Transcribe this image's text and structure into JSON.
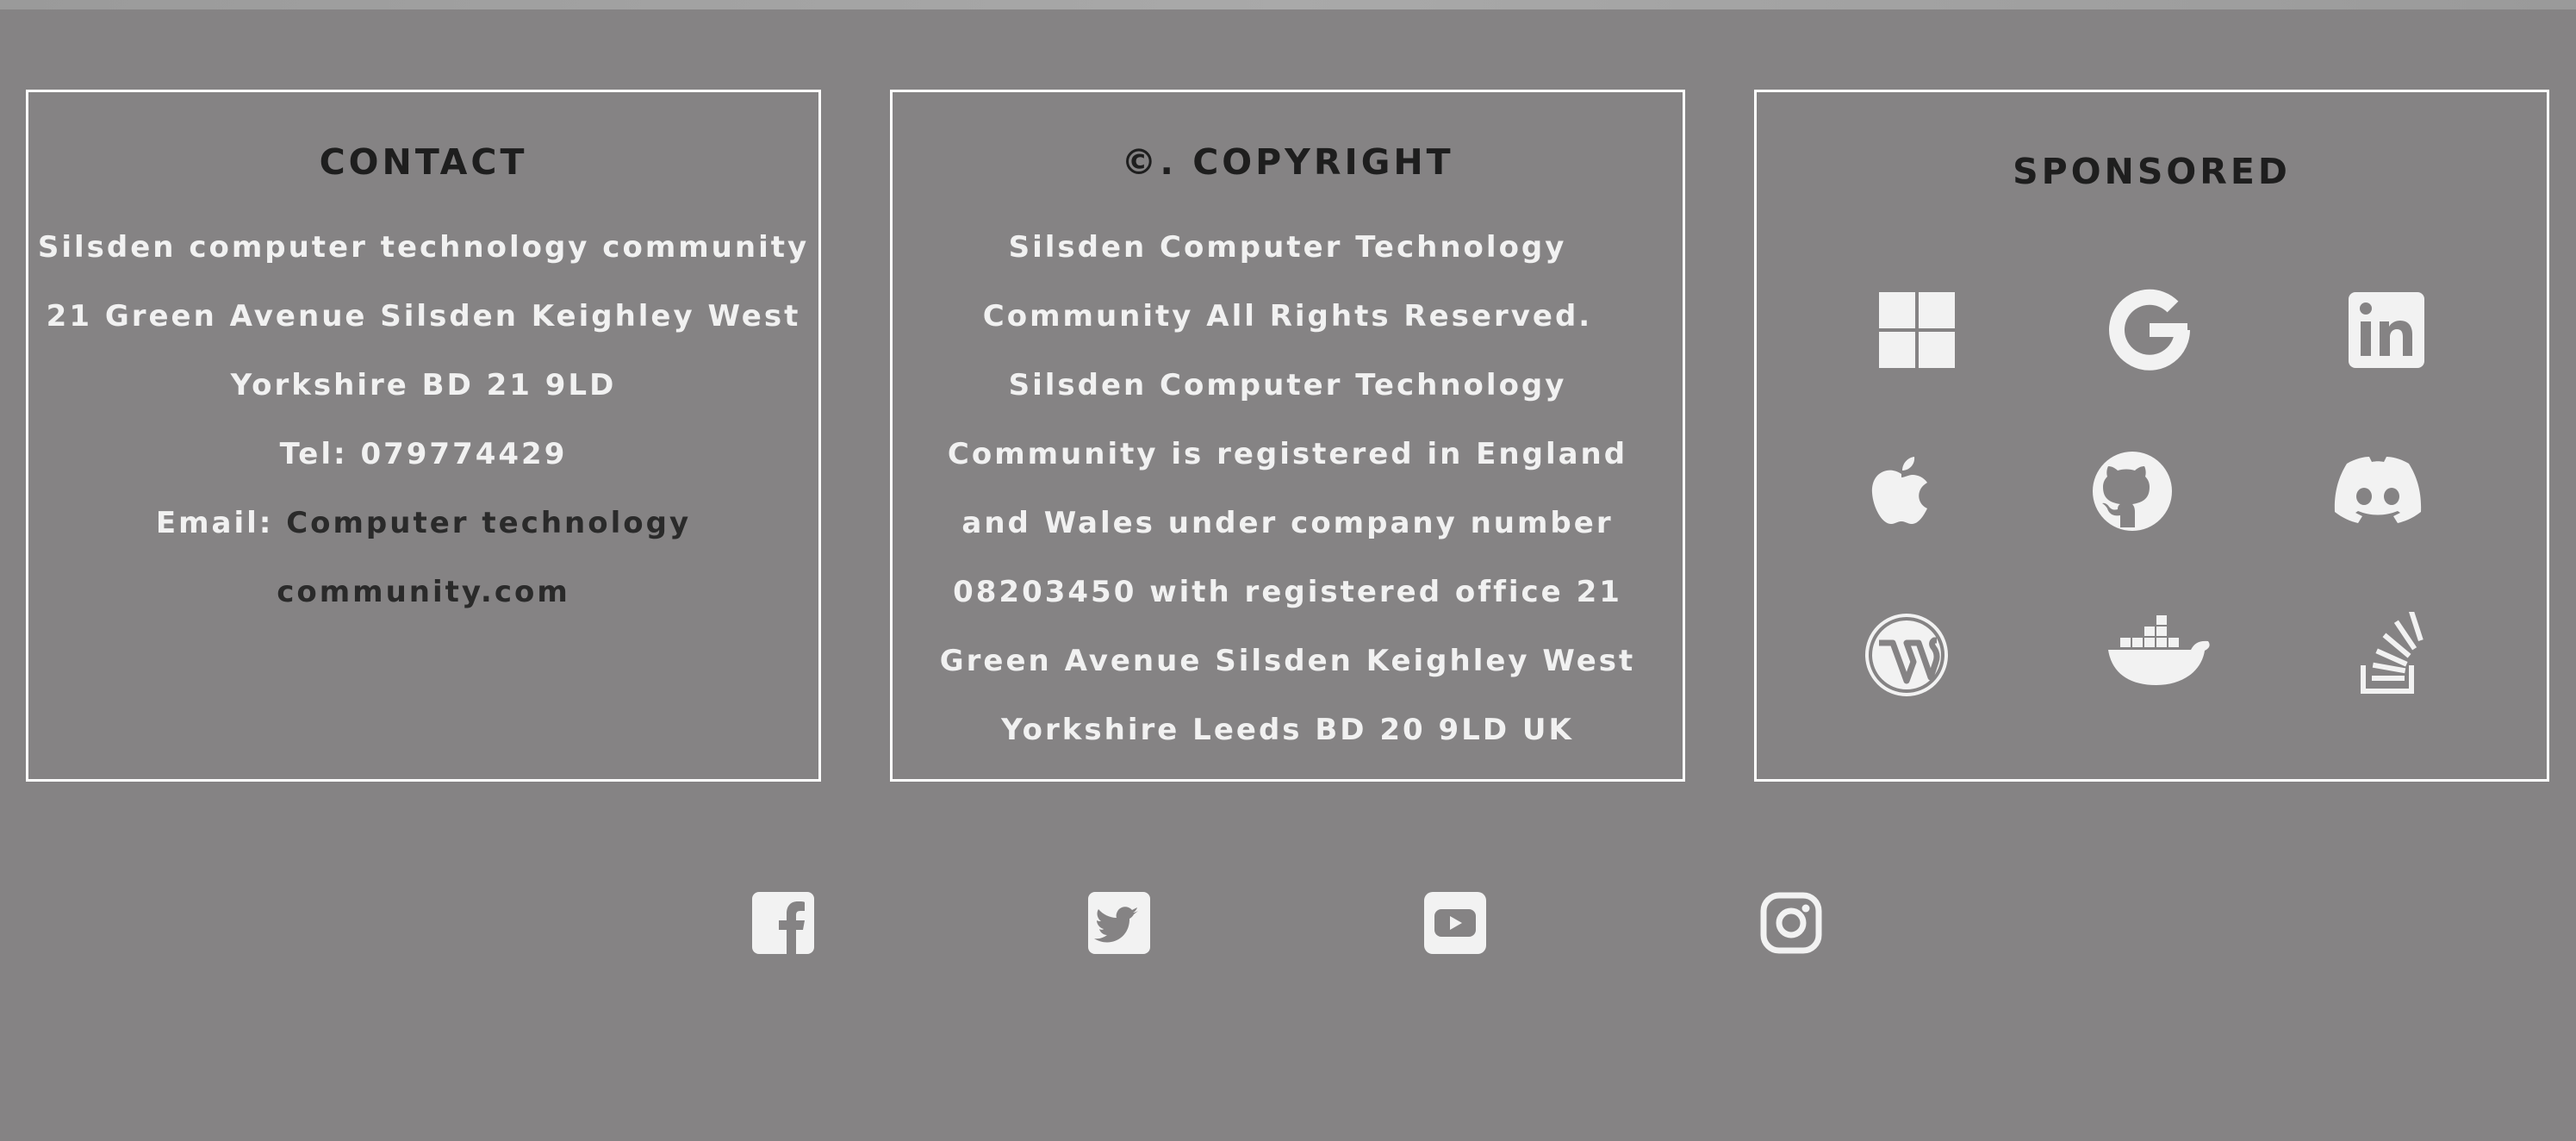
{
  "contact": {
    "heading": "CONTACT",
    "line1": "Silsden computer technology community",
    "line2": "21 Green Avenue Silsden Keighley West",
    "line3": "Yorkshire BD 21 9LD",
    "line4": "Tel: 079774429",
    "email_label": "Email: ",
    "email_link1": "Computer technology",
    "email_link2": "community.com"
  },
  "copyright": {
    "heading": "©. COPYRIGHT",
    "lines": [
      "Silsden Computer Technology",
      "Community All Rights Reserved.",
      "Silsden Computer Technology",
      "Community is registered in England",
      "and Wales under company number",
      "08203450 with registered office 21",
      "Green Avenue Silsden Keighley West",
      "Yorkshire Leeds BD 20 9LD UK"
    ]
  },
  "sponsored": {
    "heading": "SPONSORED",
    "icons": [
      "windows-icon",
      "google-icon",
      "linkedin-icon",
      "apple-icon",
      "github-icon",
      "discord-icon",
      "wordpress-icon",
      "docker-icon",
      "stackoverflow-icon"
    ]
  },
  "social": {
    "icons": [
      "facebook-icon",
      "twitter-icon",
      "youtube-icon",
      "instagram-icon"
    ]
  },
  "colors": {
    "background": "#858384",
    "text_light": "#f1f1f1",
    "text_dark": "#1e1e1e",
    "border": "#ffffff",
    "icon": "#f2f2f2"
  }
}
